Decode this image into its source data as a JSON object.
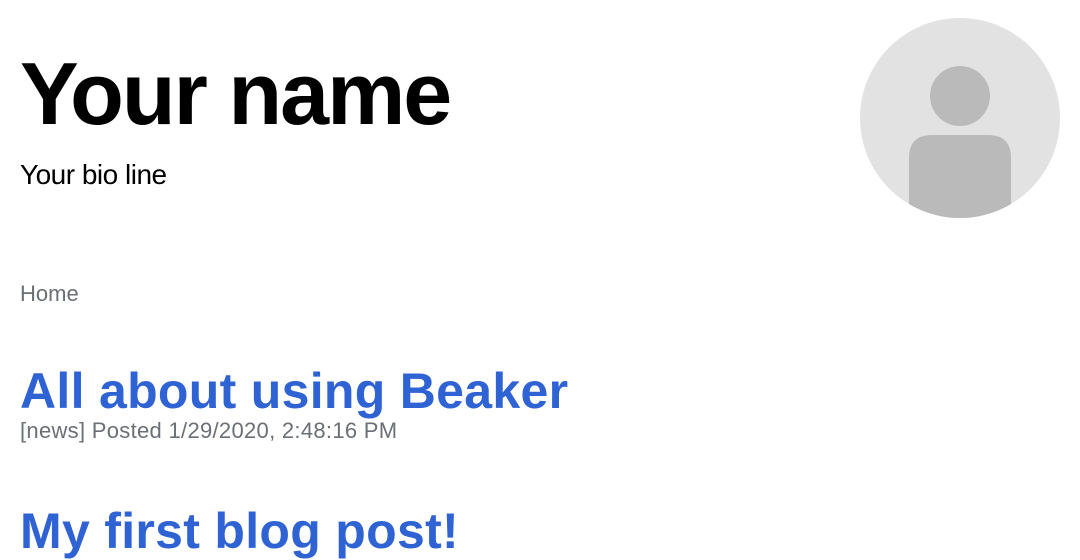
{
  "profile": {
    "name": "Your name",
    "bio": "Your bio line",
    "avatar_icon": "user-silhouette-icon"
  },
  "nav": {
    "home_label": "Home"
  },
  "posts": [
    {
      "title": "All about using Beaker",
      "meta": "[news] Posted 1/29/2020, 2:48:16 PM"
    },
    {
      "title": "My first blog post!"
    }
  ],
  "colors": {
    "link": "#2f63d4",
    "muted": "#6b6f76",
    "avatar_bg": "#e2e2e2",
    "avatar_fg": "#bababa"
  }
}
